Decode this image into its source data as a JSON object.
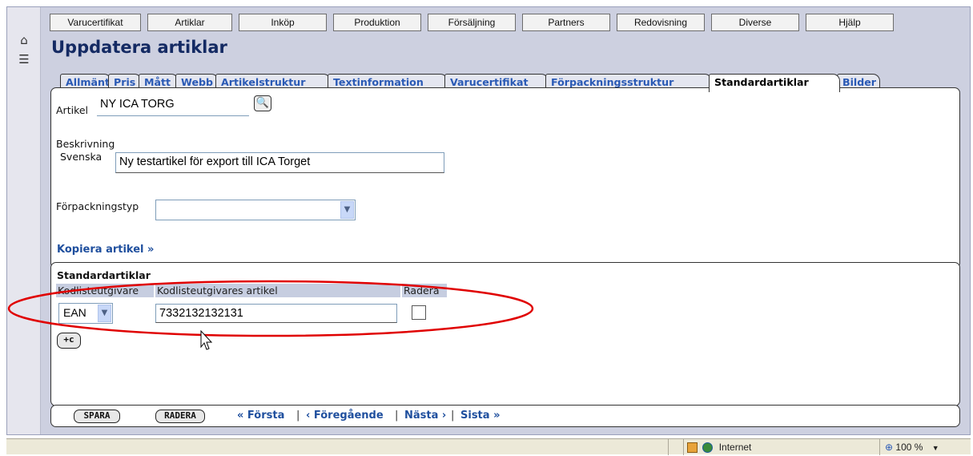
{
  "menu": [
    "Varucertifikat",
    "Artiklar",
    "Inköp",
    "Produktion",
    "Försäljning",
    "Partners",
    "Redovisning",
    "Diverse",
    "Hjälp"
  ],
  "left_icons": {
    "home": "home-icon",
    "list": "list-icon"
  },
  "page_title": "Uppdatera artiklar",
  "tabs": [
    "Allmänt",
    "Pris",
    "Mått",
    "Webb",
    "Artikelstruktur",
    "Textinformation",
    "Varucertifikat",
    "Förpackningsstruktur",
    "Standardartiklar",
    "Bilder"
  ],
  "active_tab": "Standardartiklar",
  "form": {
    "artikel_label": "Artikel",
    "artikel_value": "NY ICA TORG",
    "beskrivning_label": "Beskrivning",
    "svenska_label": "Svenska",
    "svenska_value": "Ny testartikel för export till ICA Torget",
    "forpackningstyp_label": "Förpackningstyp",
    "forpackningstyp_value": "",
    "kopiera_link": "Kopiera artikel »"
  },
  "standard": {
    "title": "Standardartiklar",
    "headers": [
      "Kodlisteutgivare",
      "Kodlisteutgivares artikel",
      "Radera"
    ],
    "rows": [
      {
        "utgivare": "EAN",
        "artikel": "7332132132131",
        "radera": false
      }
    ],
    "add_button": "+c"
  },
  "footer": {
    "spara": "SPARA",
    "radera": "RADERA",
    "forsta": "« Första",
    "foregaende": "‹ Föregående",
    "nasta": "Nästa ›",
    "sista": "Sista »",
    "sep": "|"
  },
  "statusbar": {
    "zone": "Internet",
    "zoom": "100 %"
  },
  "colors": {
    "frame": "#cdd0e0",
    "title": "#142a63",
    "link": "#1f4f9e",
    "annotation": "#e00000"
  }
}
